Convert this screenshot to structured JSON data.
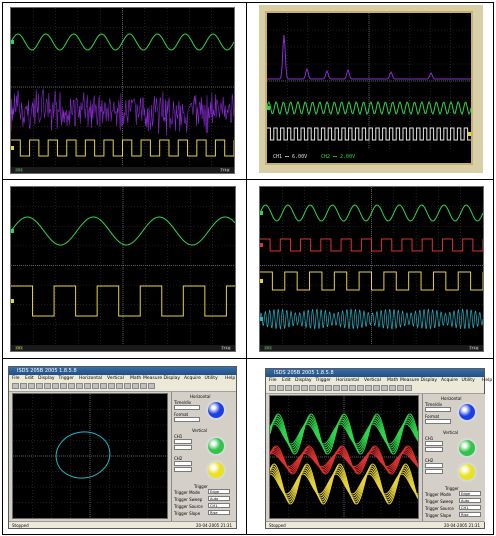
{
  "panels": [
    {
      "id": "p1",
      "traces": [
        "sine-green",
        "noise-purple",
        "square-yellow"
      ],
      "status_left": "CH1",
      "status_right": "Trig"
    },
    {
      "id": "p2",
      "traces": [
        "fft-purple",
        "sine-green",
        "square-white"
      ],
      "ch1_label": "CH1 ⎓ 6.00V",
      "ch2_label": "CH2 ⎓ 2.00V"
    },
    {
      "id": "p3",
      "traces": [
        "sine-green",
        "square-yellow"
      ],
      "status_left": "CH1",
      "status_right": "Trig"
    },
    {
      "id": "p4",
      "traces": [
        "sine-green",
        "square-red",
        "square-yellow",
        "burst-cyan"
      ],
      "status_left": "CH1",
      "status_right": "Trig"
    },
    {
      "id": "p5",
      "app_title": "ISDS 205B 2005 1.8.5.8",
      "traces": [
        "lissajous-cyan"
      ],
      "menu": [
        "File",
        "Edit",
        "Display",
        "Trigger",
        "Horizontal",
        "Vertical",
        "Math",
        "Measure",
        "Display",
        "Acquire",
        "Utility",
        "Help"
      ]
    },
    {
      "id": "p6",
      "app_title": "ISDS 205B 2005 1.8.5.8",
      "traces": [
        "sine-green-persist",
        "sine-red-persist",
        "sine-yellow-persist"
      ],
      "menu": [
        "File",
        "Edit",
        "Display",
        "Trigger",
        "Horizontal",
        "Vertical",
        "Math",
        "Measure",
        "Display",
        "Acquire",
        "Utility",
        "Help"
      ]
    }
  ],
  "app_panel": {
    "sections": [
      "Horizontal",
      "Vertical",
      "Vertical",
      "Trigger"
    ],
    "fields": {
      "h1": "Time/div",
      "h2": "Format",
      "vunit": "CH1",
      "vunit2": "CH2",
      "trig_mode": "Trigger Mode",
      "trig_sweep": "Trigger Sweep",
      "trig_source": "Trigger Source",
      "trig_slope": "Trigger Slope"
    },
    "values": {
      "tm": "Edge",
      "ts": "Auto",
      "tsrc": "CH1",
      "tsl": "Rise"
    },
    "status": "Stopped",
    "date": "20-04-2005  21:31"
  },
  "colors": {
    "green": "#2fd64a",
    "purple": "#8a2bd6",
    "yellow": "#e6d33a",
    "red": "#e03030",
    "cyan": "#22b5c8",
    "white": "#e8e8e8",
    "blue_knob": "#1b3fe6",
    "green_knob": "#2fc44a",
    "yellow_knob": "#e8e21f"
  }
}
